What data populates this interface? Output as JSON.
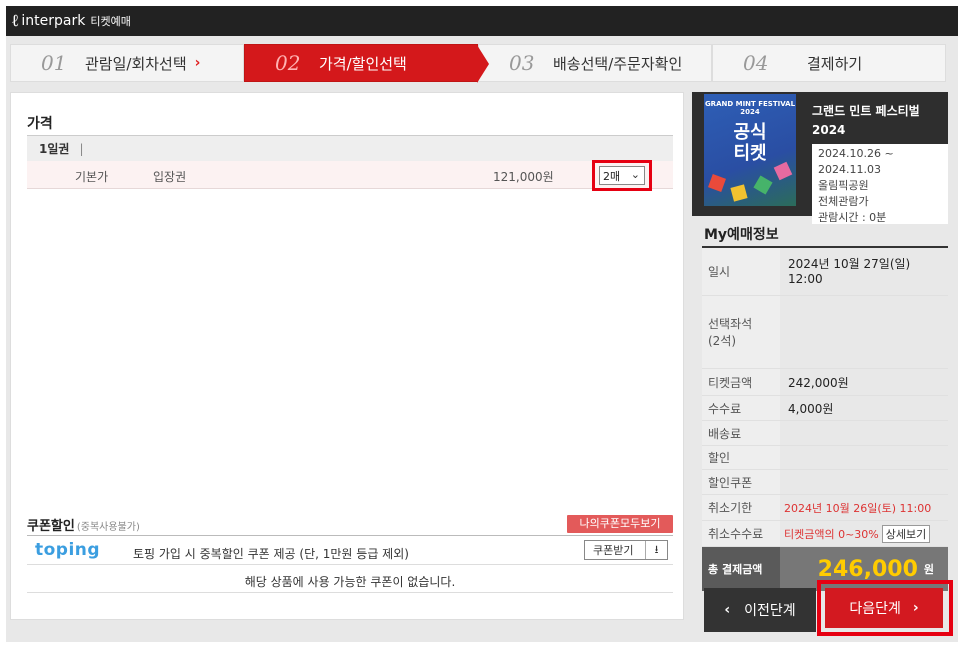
{
  "header": {
    "logo_mark": "ℓ",
    "brand": "interpark",
    "sub": "티켓예매"
  },
  "steps": [
    {
      "num": "01",
      "label": "관람일/회차선택",
      "arrow": "›"
    },
    {
      "num": "02",
      "label": "가격/할인선택"
    },
    {
      "num": "03",
      "label": "배송선택/주문자확인"
    },
    {
      "num": "04",
      "label": "결제하기"
    }
  ],
  "price": {
    "title": "가격",
    "group_label": "1일권",
    "group_bar": "|",
    "row": {
      "type": "기본가",
      "name": "입장권",
      "amount": "121,000원",
      "qty": "2매"
    }
  },
  "coupon": {
    "title": "쿠폰할인",
    "title_note": "(중복사용불가)",
    "my_coupon_btn": "나의쿠폰모두보기",
    "toping_logo": "toping",
    "toping_text": "토핑 가입 시 중복할인 쿠폰 제공 (단, 1만원 등급 제외)",
    "get_coupon_btn": "쿠폰받기",
    "no_coupon": "해당 상품에 사용 가능한 쿠폰이 없습니다."
  },
  "show": {
    "poster_top": "GRAND MINT FESTIVAL 2024",
    "poster_main": "공식\n티켓",
    "title": "그랜드 민트 페스티벌 2024",
    "info": [
      "2024.10.26 ~",
      "2024.11.03",
      "올림픽공원",
      "전체관람가",
      "관람시간 : 0분"
    ]
  },
  "my_info": {
    "title": "My예매정보",
    "rows": [
      {
        "k": "일시",
        "v": "2024년 10월 27일(일) 12:00"
      },
      {
        "k": "선택좌석\n(2석)",
        "v": ""
      },
      {
        "k": "티켓금액",
        "v": "242,000원"
      },
      {
        "k": "수수료",
        "v": "4,000원"
      },
      {
        "k": "배송료",
        "v": ""
      },
      {
        "k": "할인",
        "v": ""
      },
      {
        "k": "할인쿠폰",
        "v": ""
      },
      {
        "k": "취소기한",
        "v": "2024년 10월 26일(토) 11:00"
      },
      {
        "k": "취소수수료",
        "v": "티켓금액의 0~30%",
        "btn": "상세보기"
      }
    ],
    "total_label": "총 결제금액",
    "total_value": "246,000",
    "total_unit": "원"
  },
  "buttons": {
    "prev": "이전단계",
    "next": "다음단계",
    "prev_icon": "‹",
    "next_icon": "›"
  },
  "colors": {
    "accent": "#d4181b",
    "highlight": "#e60012",
    "total": "#ffcc00"
  }
}
